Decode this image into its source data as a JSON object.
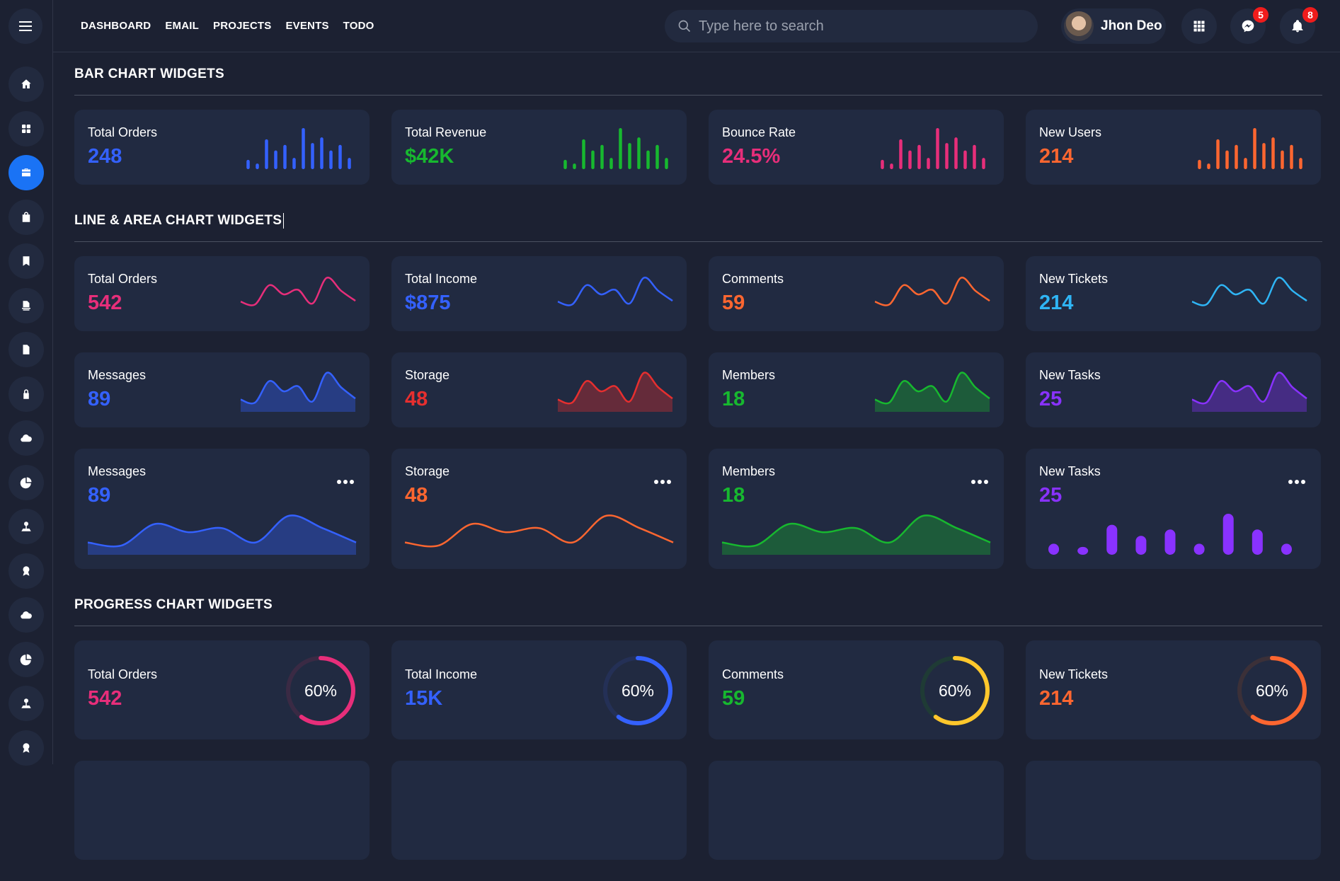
{
  "topbar": {
    "menu_icon": "hamburger-icon",
    "nav": [
      "DASHBOARD",
      "EMAIL",
      "PROJECTS",
      "EVENTS",
      "TODO"
    ],
    "search_placeholder": "Type here to search",
    "search_value": "",
    "user_name": "Jhon Deo",
    "messages_badge": "5",
    "notifications_badge": "8"
  },
  "sidebar": {
    "items": [
      {
        "icon": "home-icon",
        "active": false
      },
      {
        "icon": "grid-icon",
        "active": false
      },
      {
        "icon": "briefcase-icon",
        "active": true
      },
      {
        "icon": "shopping-bag-check-icon",
        "active": false
      },
      {
        "icon": "bookmark-star-icon",
        "active": false
      },
      {
        "icon": "file-stack-icon",
        "active": false
      },
      {
        "icon": "spreadsheet-icon",
        "active": false
      },
      {
        "icon": "lock-icon",
        "active": false
      },
      {
        "icon": "cloud-download-icon",
        "active": false
      },
      {
        "icon": "pie-chart-icon",
        "active": false
      },
      {
        "icon": "map-pin-user-icon",
        "active": false
      },
      {
        "icon": "award-icon",
        "active": false
      },
      {
        "icon": "cloud-download-icon",
        "active": false
      },
      {
        "icon": "pie-chart-icon",
        "active": false
      },
      {
        "icon": "map-pin-user-icon",
        "active": false
      },
      {
        "icon": "award-icon",
        "active": false
      }
    ]
  },
  "sections": {
    "bar": "BAR CHART WIDGETS",
    "line": "LINE & AREA CHART WIDGETS",
    "progress": "PROGRESS CHART WIDGETS"
  },
  "colors": {
    "blue": "#3461ff",
    "green": "#17b82f",
    "pink": "#e72e7a",
    "orange": "#fd6630",
    "cyan": "#2fb5f5",
    "red": "#e62f2f",
    "purple": "#8932ff",
    "yellow": "#ffc72c"
  },
  "bar_widgets": [
    {
      "label": "Total Orders",
      "value": "248",
      "color": "#3461ff"
    },
    {
      "label": "Total Revenue",
      "value": "$42K",
      "color": "#17b82f"
    },
    {
      "label": "Bounce Rate",
      "value": "24.5%",
      "color": "#e72e7a"
    },
    {
      "label": "New Users",
      "value": "214",
      "color": "#fd6630"
    }
  ],
  "line_widgets": [
    {
      "label": "Total Orders",
      "value": "542",
      "color": "#e72e7a"
    },
    {
      "label": "Total Income",
      "value": "$875",
      "color": "#3461ff"
    },
    {
      "label": "Comments",
      "value": "59",
      "color": "#fd6630"
    },
    {
      "label": "New Tickets",
      "value": "214",
      "color": "#2fb5f5"
    }
  ],
  "area_widgets": [
    {
      "label": "Messages",
      "value": "89",
      "color": "#3461ff"
    },
    {
      "label": "Storage",
      "value": "48",
      "color": "#e62f2f"
    },
    {
      "label": "Members",
      "value": "18",
      "color": "#17b82f"
    },
    {
      "label": "New Tasks",
      "value": "25",
      "color": "#8932ff"
    }
  ],
  "big_widgets": [
    {
      "label": "Messages",
      "value": "89",
      "color": "#3461ff",
      "kind": "area"
    },
    {
      "label": "Storage",
      "value": "48",
      "color": "#fd6630",
      "kind": "line"
    },
    {
      "label": "Members",
      "value": "18",
      "color": "#17b82f",
      "kind": "area"
    },
    {
      "label": "New Tasks",
      "value": "25",
      "color": "#8932ff",
      "kind": "bar"
    }
  ],
  "progress_widgets": [
    {
      "label": "Total Orders",
      "value": "542",
      "color": "#e72e7a",
      "track": "#3a2a44",
      "percent": 60,
      "percent_label": "60%",
      "value_color": "#e72e7a"
    },
    {
      "label": "Total Income",
      "value": "15K",
      "color": "#3461ff",
      "track": "#243056",
      "percent": 60,
      "percent_label": "60%",
      "value_color": "#3461ff"
    },
    {
      "label": "Comments",
      "value": "59",
      "color": "#ffc72c",
      "track": "#1f3b35",
      "percent": 60,
      "percent_label": "60%",
      "value_color": "#17b82f"
    },
    {
      "label": "New Tickets",
      "value": "214",
      "color": "#fd6630",
      "track": "#3b3038",
      "percent": 60,
      "percent_label": "60%",
      "value_color": "#fd6630"
    }
  ],
  "chart_data": [
    {
      "type": "bar",
      "name": "mini-bar-series",
      "values": [
        5,
        3,
        16,
        10,
        13,
        6,
        22,
        14,
        17,
        10,
        13,
        6
      ]
    },
    {
      "type": "line",
      "name": "mini-line-series",
      "values": [
        12,
        9,
        30,
        20,
        25,
        10,
        38,
        24,
        13
      ]
    },
    {
      "type": "area",
      "name": "big-area-series",
      "values": [
        12,
        9,
        30,
        22,
        26,
        12,
        38,
        26,
        12
      ]
    },
    {
      "type": "bar",
      "name": "big-bar-series",
      "values": [
        7,
        5,
        19,
        12,
        16,
        7,
        26,
        16,
        7
      ]
    }
  ]
}
